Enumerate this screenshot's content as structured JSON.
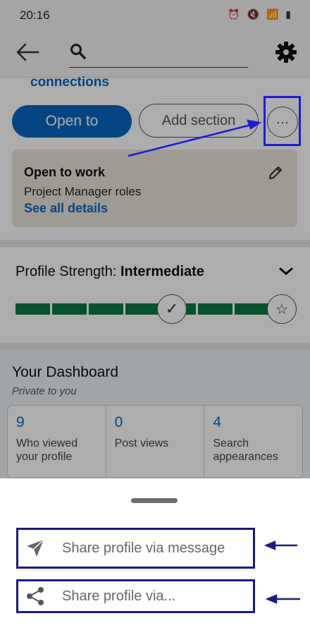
{
  "status_bar": {
    "time": "20:16",
    "icons": "⏰ 🔇 📶 ▮"
  },
  "header": {
    "search_placeholder": ""
  },
  "profile": {
    "connections_label": "connections",
    "open_to_label": "Open to",
    "add_section_label": "Add section",
    "more_label": "···"
  },
  "open_to_work": {
    "title": "Open to work",
    "subtitle": "Project Manager roles",
    "link": "See all details"
  },
  "profile_strength": {
    "label": "Profile Strength:",
    "level": "Intermediate",
    "progress_fraction": 0.93
  },
  "dashboard": {
    "title": "Your Dashboard",
    "subtitle": "Private to you",
    "stats": [
      {
        "value": "9",
        "label": "Who viewed your profile"
      },
      {
        "value": "0",
        "label": "Post views"
      },
      {
        "value": "4",
        "label": "Search appearances"
      }
    ]
  },
  "share_sheet": {
    "items": [
      {
        "label": "Share profile via message",
        "icon": "send-icon"
      },
      {
        "label": "Share profile via...",
        "icon": "share-icon"
      }
    ]
  },
  "colors": {
    "accent": "#0a66c2",
    "progress": "#0b7a3e",
    "annotation": "#1d1dd6"
  }
}
